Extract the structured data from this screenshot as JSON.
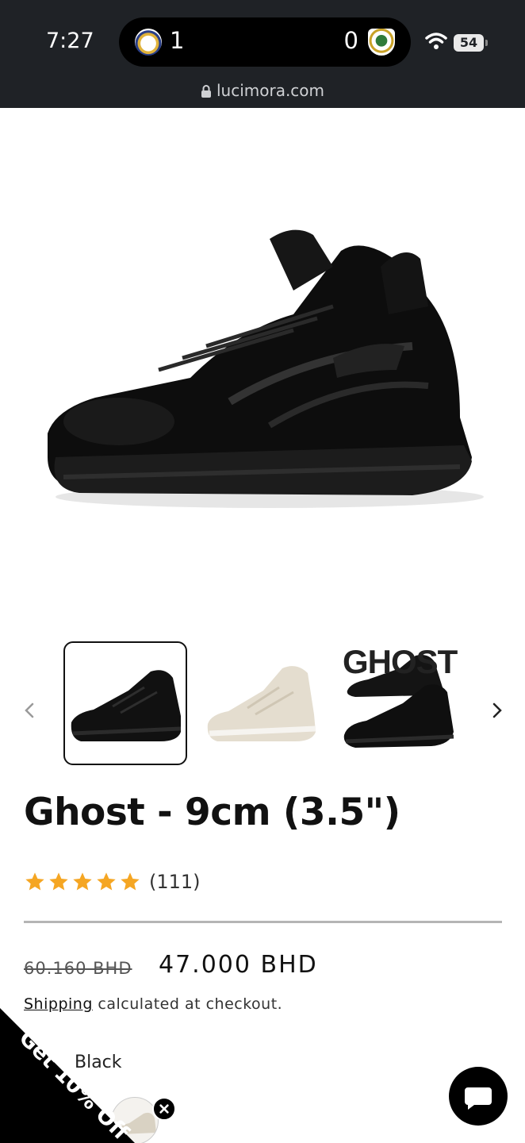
{
  "status_bar": {
    "time": "7:27",
    "live_activity": {
      "home_score": "1",
      "away_score": "0"
    },
    "battery": "54"
  },
  "browser": {
    "url": "lucimora.com"
  },
  "gallery": {
    "main_image_alt": "black chunky sneaker",
    "thumbnails": [
      {
        "alt": "black sneaker",
        "selected": true
      },
      {
        "alt": "beige sneaker",
        "selected": false
      },
      {
        "alt": "pair of black sneakers",
        "label": "GHOST",
        "selected": false
      }
    ]
  },
  "product": {
    "title": "Ghost - 9cm (3.5\")",
    "rating_stars": 5,
    "review_count": "(111)",
    "compare_price": "60.160 BHD",
    "price": "47.000 BHD",
    "shipping_link": "Shipping",
    "shipping_rest": " calculated at checkout.",
    "color_label": "Black"
  },
  "promo": {
    "text": "Get 10% Off"
  },
  "colors": {
    "topbar": "#1f2226",
    "star": "#f5a623",
    "text": "#111111"
  }
}
